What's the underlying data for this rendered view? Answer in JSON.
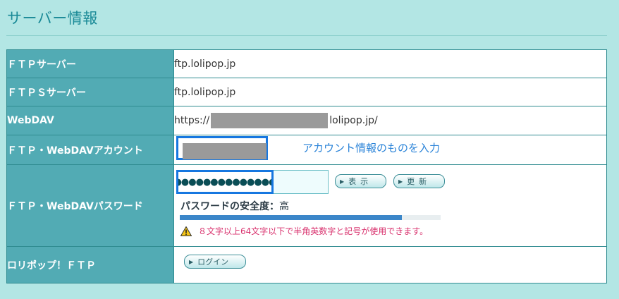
{
  "title": "サーバー情報",
  "rows": [
    {
      "label": "ＦＴＰサーバー",
      "value": "ftp.lolipop.jp"
    },
    {
      "label": "ＦＴＰＳサーバー",
      "value": "ftp.lolipop.jp"
    },
    {
      "label": "WebDAV",
      "value_prefix": "https://",
      "value_suffix": "lolipop.jp/"
    },
    {
      "label": "ＦＴＰ・WebDAVアカウント",
      "hint": "アカウント情報のものを入力"
    },
    {
      "label": "ＦＴＰ・WebDAVパスワード",
      "password_value": "●●●●●●●●●●●●●●●●●●",
      "show_button": "表示",
      "update_button": "更新",
      "strength_label": "パスワードの安全度：",
      "strength_value": "高",
      "strength_fraction": 0.85,
      "warning": "８文字以上64文字以下で半角英数字と記号が使用できます。"
    },
    {
      "label": "ロリポップ！ＦＴＰ",
      "login_button": "ログイン"
    }
  ],
  "colors": {
    "background": "#b3e6e4",
    "label_bg": "#52abb4",
    "highlight_border": "#1677e0",
    "hint_text": "#2a83d8",
    "warning_text": "#d9326e",
    "strength_bar": "#3b86c9"
  },
  "icons": {
    "warning": "warning-triangle-icon",
    "button_arrow": "triangle-right-icon"
  }
}
